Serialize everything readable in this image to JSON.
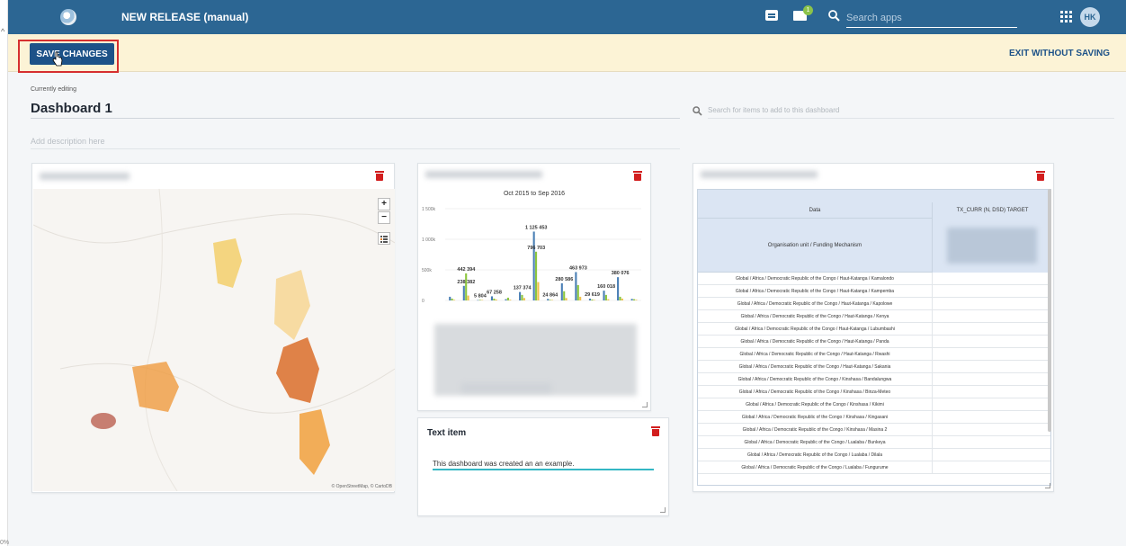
{
  "topbar": {
    "title": "NEW RELEASE (manual)",
    "search_placeholder": "Search apps",
    "mail_badge": "1",
    "avatar_initials": "HK"
  },
  "savebar": {
    "save_label": "SAVE CHANGES",
    "exit_label": "EXIT WITHOUT SAVING"
  },
  "editor": {
    "editing_label": "Currently editing",
    "dashboard_title": "Dashboard 1",
    "description_placeholder": "Add description here",
    "item_search_placeholder": "Search for items to add to this dashboard"
  },
  "map_card": {
    "attribution": "© OpenStreetMap, © CartoDB",
    "zoom_in": "+",
    "zoom_out": "−"
  },
  "chart_card": {
    "period": "Oct 2015 to Sep 2016"
  },
  "chart_data": {
    "type": "bar",
    "title": "Oct 2015 to Sep 2016",
    "ylim": [
      0,
      1500000
    ],
    "yticks": [
      "0",
      "500k",
      "1 000k",
      "1 500k"
    ],
    "data_labels": [
      "1 125 453",
      "796 703",
      "442 394",
      "463 973",
      "238 382",
      "280 586",
      "380 076",
      "137 374",
      "160 018",
      "67 258",
      "24 864",
      "5 804",
      "29 619"
    ],
    "series": [
      {
        "color": "#4a7fb5",
        "values": [
          60000,
          238382,
          5804,
          67258,
          20000,
          137374,
          1125453,
          24864,
          280586,
          463973,
          29619,
          160018,
          380076,
          25000
        ]
      },
      {
        "color": "#8cc63f",
        "values": [
          30000,
          442394,
          10000,
          30000,
          45000,
          90000,
          796703,
          10000,
          150000,
          250000,
          15000,
          90000,
          60000,
          20000
        ]
      },
      {
        "color": "#f2c14e",
        "values": [
          10000,
          80000,
          8000,
          15000,
          12000,
          40000,
          300000,
          8000,
          40000,
          60000,
          8000,
          20000,
          30000,
          10000
        ]
      }
    ]
  },
  "table_card": {
    "col_data": "Data",
    "col_tx": "TX_CURR (N, DSD) TARGET",
    "col_org": "Organisation unit / Funding Mechanism",
    "rows": [
      "Global / Africa / Democratic Republic of the Congo / Haut-Katanga / Kamalondo",
      "Global / Africa / Democratic Republic of the Congo / Haut-Katanga / Kampemba",
      "Global / Africa / Democratic Republic of the Congo / Haut-Katanga / Kapolowe",
      "Global / Africa / Democratic Republic of the Congo / Haut-Katanga / Kenya",
      "Global / Africa / Democratic Republic of the Congo / Haut-Katanga / Lubumbashi",
      "Global / Africa / Democratic Republic of the Congo / Haut-Katanga / Panda",
      "Global / Africa / Democratic Republic of the Congo / Haut-Katanga / Rwashi",
      "Global / Africa / Democratic Republic of the Congo / Haut-Katanga / Sakania",
      "Global / Africa / Democratic Republic of the Congo / Kinshasa / Bandalungwa",
      "Global / Africa / Democratic Republic of the Congo / Kinshasa / Binza-Meteo",
      "Global / Africa / Democratic Republic of the Congo / Kinshasa / Kikimi",
      "Global / Africa / Democratic Republic of the Congo / Kinshasa / Kingasani",
      "Global / Africa / Democratic Republic of the Congo / Kinshasa / Masina 2",
      "Global / Africa / Democratic Republic of the Congo / Lualaba / Bunkeya",
      "Global / Africa / Democratic Republic of the Congo / Lualaba / Dilala",
      "Global / Africa / Democratic Republic of the Congo / Lualaba / Fungurume"
    ]
  },
  "text_card": {
    "title": "Text item",
    "content": "This dashboard was created an an example."
  },
  "gutter": {
    "zoom_pct": "0%"
  },
  "colors": {
    "topbar": "#2c6693",
    "savebar": "#fcf3d6",
    "save_button": "#1d5288",
    "highlight": "#d62f2f",
    "delete": "#d21e1e",
    "text_underline": "#34b7c4"
  }
}
